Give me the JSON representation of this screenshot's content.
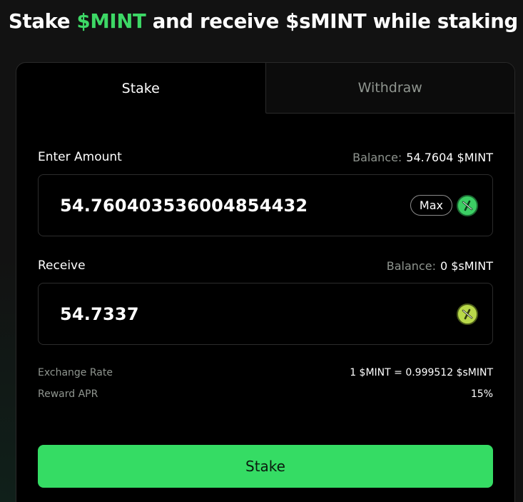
{
  "headline": {
    "prefix": "Stake ",
    "token": "$MINT",
    "suffix": " and receive $sMINT while staking"
  },
  "tabs": [
    {
      "label": "Stake",
      "active": true
    },
    {
      "label": "Withdraw",
      "active": false
    }
  ],
  "enter_amount": {
    "label": "Enter Amount",
    "balance_label": "Balance:",
    "balance_value": "54.7604 $MINT",
    "value": "54.760403536004854432",
    "max_label": "Max",
    "icon": "mint-token-icon"
  },
  "receive": {
    "label": "Receive",
    "balance_label": "Balance:",
    "balance_value": "0 $sMINT",
    "value": "54.7337",
    "icon": "smint-token-icon"
  },
  "info": {
    "exchange_rate_label": "Exchange Rate",
    "exchange_rate_value": "1 $MINT = 0.999512 $sMINT",
    "reward_apr_label": "Reward APR",
    "reward_apr_value": "15%"
  },
  "action": {
    "stake_label": "Stake"
  },
  "colors": {
    "accent": "#3dd866",
    "button": "#35dc64",
    "background": "#000000",
    "muted_text": "#8f958f"
  }
}
